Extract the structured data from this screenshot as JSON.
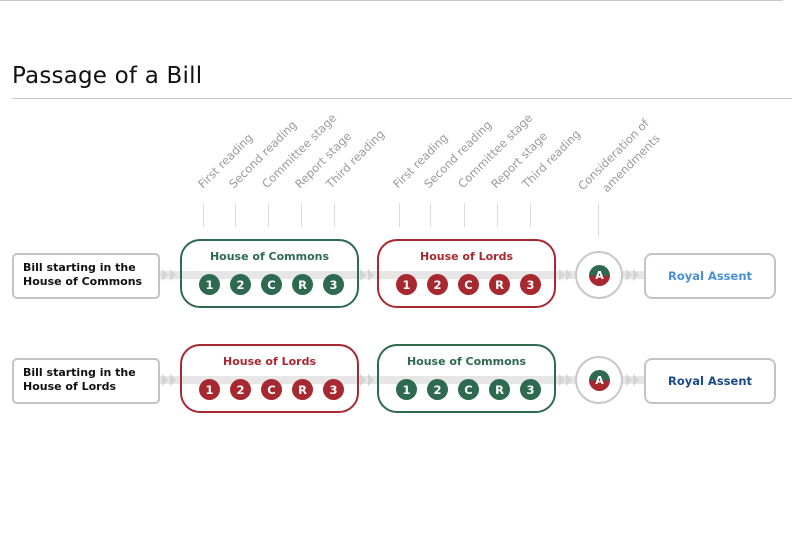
{
  "title": "Passage of a Bill",
  "stage_labels": {
    "house1": [
      "First reading",
      "Second reading",
      "Committee stage",
      "Report stage",
      "Third reading"
    ],
    "house2": [
      "First reading",
      "Second reading",
      "Committee stage",
      "Report stage",
      "Third reading"
    ],
    "amendments": [
      "Consideration of",
      "amendments"
    ]
  },
  "rows": [
    {
      "start": [
        "Bill starting in the",
        "House of Commons"
      ],
      "first_house": {
        "name": "House of Commons",
        "color": "#2d6a4f",
        "stages": [
          "1",
          "2",
          "C",
          "R",
          "3"
        ]
      },
      "second_house": {
        "name": "House of Lords",
        "color": "#a8282f",
        "stages": [
          "1",
          "2",
          "C",
          "R",
          "3"
        ]
      },
      "amendment_stage": "A",
      "end": {
        "label": "Royal Assent",
        "color": "#4a90d9"
      }
    },
    {
      "start": [
        "Bill starting in the",
        "House of Lords"
      ],
      "first_house": {
        "name": "House of Lords",
        "color": "#a8282f",
        "stages": [
          "1",
          "2",
          "C",
          "R",
          "3"
        ]
      },
      "second_house": {
        "name": "House of Commons",
        "color": "#2d6a4f",
        "stages": [
          "1",
          "2",
          "C",
          "R",
          "3"
        ]
      },
      "amendment_stage": "A",
      "end": {
        "label": "Royal Assent",
        "color": "#1a4a8a"
      }
    }
  ],
  "colors": {
    "commons": "#2d6a4f",
    "lords": "#a8282f",
    "neutral": "#c4c4c4"
  }
}
